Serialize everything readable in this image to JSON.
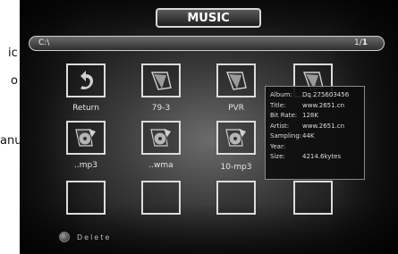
{
  "left_fragments": [
    "ic",
    "o",
    "anu"
  ],
  "header": {
    "title": "MUSIC"
  },
  "path_bar": {
    "path": "C:\\",
    "page_current": "1",
    "page_sep": "/",
    "page_total": "1"
  },
  "grid": {
    "row1": [
      {
        "label": "Return",
        "icon": "return-arrow-icon"
      },
      {
        "label": "79-3",
        "icon": "music-file-icon"
      },
      {
        "label": "PVR",
        "icon": "music-file-icon"
      },
      {
        "label": "",
        "icon": "music-file-icon"
      }
    ],
    "row2": [
      {
        "label": "..mp3",
        "icon": "disc-file-icon"
      },
      {
        "label": "..wma",
        "icon": "disc-file-icon"
      },
      {
        "label": "10-mp3",
        "icon": "disc-file-icon"
      },
      {
        "label": "",
        "icon": "disc-file-icon"
      }
    ]
  },
  "info_popup": {
    "rows": [
      {
        "key": "Album:",
        "value": "Dq 275603456"
      },
      {
        "key": "Title:",
        "value": "www.2651.cn"
      },
      {
        "key": "Bit Rate:",
        "value": "128K"
      },
      {
        "key": "Artist:",
        "value": "www.2651.cn"
      },
      {
        "key": "Sampling:",
        "value": "44K"
      },
      {
        "key": "Year:",
        "value": ""
      },
      {
        "key": "Size:",
        "value": "4214.6kytes"
      }
    ]
  },
  "footer": {
    "delete_label": "Delete"
  },
  "colors": {
    "background_center": "#6b6b6b",
    "border": "#dcdcdc",
    "text": "#e6e6e6"
  }
}
